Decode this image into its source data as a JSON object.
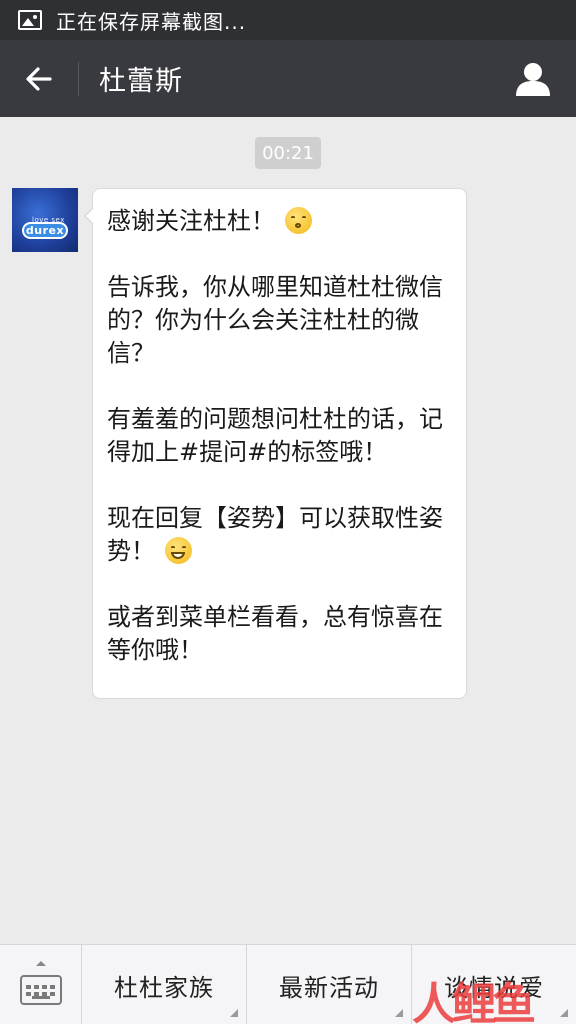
{
  "status_bar": {
    "text": "正在保存屏幕截图..."
  },
  "nav": {
    "title": "杜蕾斯"
  },
  "chat": {
    "timestamp": "00:21",
    "avatar": {
      "brand": "durex",
      "tagline": "love sex"
    },
    "message": {
      "paragraphs": [
        "感谢关注杜杜！",
        "告诉我，你从哪里知道杜杜微信的？你为什么会关注杜杜的微信？",
        "有羞羞的问题想问杜杜的话，记得加上#提问#的标签哦！",
        "现在回复【姿势】可以获取性姿势！",
        "或者到菜单栏看看，总有惊喜在等你哦！"
      ]
    }
  },
  "menu": {
    "items": [
      "杜杜家族",
      "最新活动",
      "谈情说爱"
    ]
  },
  "watermark": {
    "text": "人鲤鱼"
  }
}
